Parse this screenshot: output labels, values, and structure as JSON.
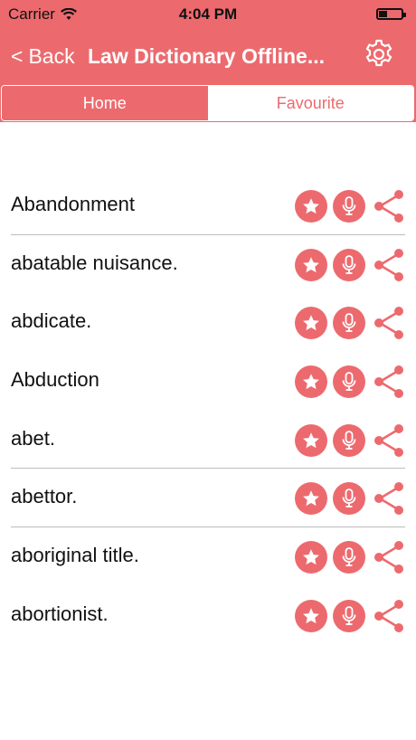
{
  "status": {
    "carrier": "Carrier",
    "time": "4:04 PM"
  },
  "nav": {
    "back_label": "Back",
    "title": "Law Dictionary Offline..."
  },
  "tabs": [
    {
      "label": "Home",
      "active": true
    },
    {
      "label": "Favourite",
      "active": false
    }
  ],
  "colors": {
    "accent": "#ec6a6e",
    "separator": "#bdbdbd"
  },
  "words": [
    {
      "label": "Abandonment",
      "separator": true
    },
    {
      "label": "abatable nuisance.",
      "separator": false
    },
    {
      "label": "abdicate.",
      "separator": false
    },
    {
      "label": "Abduction",
      "separator": false
    },
    {
      "label": "abet.",
      "separator": true
    },
    {
      "label": "abettor.",
      "separator": true
    },
    {
      "label": "aboriginal title.",
      "separator": false
    },
    {
      "label": "abortionist.",
      "separator": false
    }
  ],
  "icons": {
    "favourite": "star-icon",
    "pronounce": "microphone-icon",
    "share": "share-icon",
    "settings": "gear-icon"
  }
}
